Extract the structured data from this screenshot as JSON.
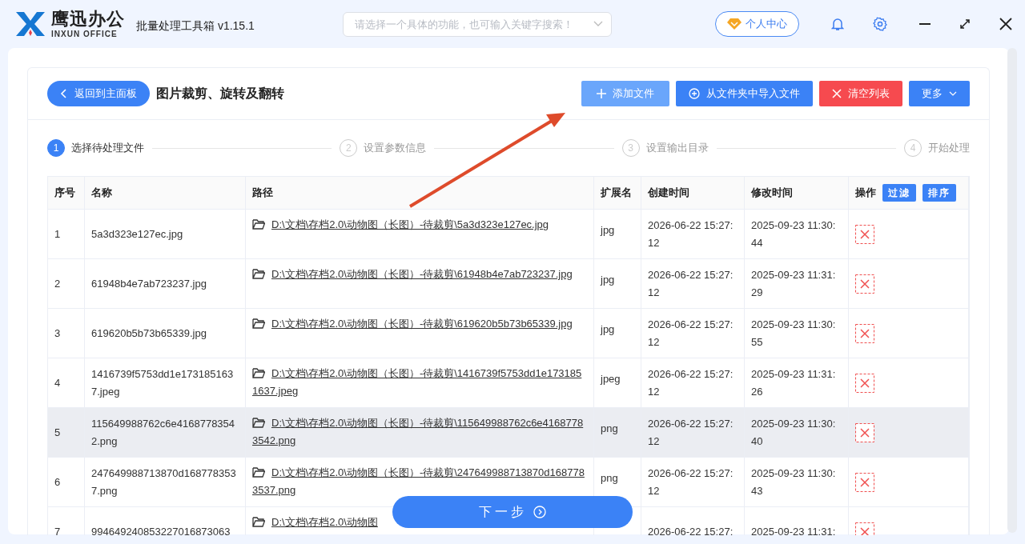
{
  "app": {
    "logo_cn": "鹰迅办公",
    "logo_en": "INXUN OFFICE",
    "title": "批量处理工具箱 v1.15.1"
  },
  "search": {
    "placeholder": "请选择一个具体的功能，也可输入关键字搜索！"
  },
  "user_center": "个人中心",
  "toolbar": {
    "back": "返回到主面板",
    "title": "图片裁剪、旋转及翻转",
    "buttons": [
      {
        "kind": "add",
        "label": "添加文件"
      },
      {
        "kind": "import",
        "label": "从文件夹中导入文件"
      },
      {
        "kind": "clear",
        "label": "清空列表"
      },
      {
        "kind": "more",
        "label": "更多"
      }
    ]
  },
  "steps": [
    {
      "number": "1",
      "label": "选择待处理文件",
      "selected": true
    },
    {
      "number": "2",
      "label": "设置参数信息",
      "selected": false
    },
    {
      "number": "3",
      "label": "设置输出目录",
      "selected": false
    },
    {
      "number": "4",
      "label": "开始处理",
      "selected": false
    }
  ],
  "table": {
    "columns": [
      "序号",
      "名称",
      "路径",
      "扩展名",
      "创建时间",
      "修改时间",
      "操作"
    ],
    "filter": "过滤",
    "sort": "排序",
    "rows": [
      {
        "index": "1",
        "name": "5a3d323e127ec.jpg",
        "path": "D:\\文档\\存档2.0\\动物图（长图）-待裁剪\\5a3d323e127ec.jpg",
        "ext": "jpg",
        "created": "2026-06-22 15:27:12",
        "modified": "2025-09-23 11:30:44",
        "selected": false
      },
      {
        "index": "2",
        "name": "61948b4e7ab723237.jpg",
        "path": "D:\\文档\\存档2.0\\动物图（长图）-待裁剪\\61948b4e7ab723237.jpg",
        "ext": "jpg",
        "created": "2026-06-22 15:27:12",
        "modified": "2025-09-23 11:31:29",
        "selected": false
      },
      {
        "index": "3",
        "name": "619620b5b73b65339.jpg",
        "path": "D:\\文档\\存档2.0\\动物图（长图）-待裁剪\\619620b5b73b65339.jpg",
        "ext": "jpg",
        "created": "2026-06-22 15:27:12",
        "modified": "2025-09-23 11:30:55",
        "selected": false
      },
      {
        "index": "4",
        "name": "1416739f5753dd1e1731851637.jpeg",
        "path": "D:\\文档\\存档2.0\\动物图（长图）-待裁剪\\1416739f5753dd1e1731851637.jpeg",
        "ext": "jpeg",
        "created": "2026-06-22 15:27:12",
        "modified": "2025-09-23 11:31:26",
        "selected": false
      },
      {
        "index": "5",
        "name": "115649988762c6e41687783542.png",
        "path": "D:\\文档\\存档2.0\\动物图（长图）-待裁剪\\115649988762c6e41687783542.png",
        "ext": "png",
        "created": "2026-06-22 15:27:12",
        "modified": "2025-09-23 11:30:40",
        "selected": true
      },
      {
        "index": "6",
        "name": "247649988713870d1687783537.png",
        "path": "D:\\文档\\存档2.0\\动物图（长图）-待裁剪\\247649988713870d1687783537.png",
        "ext": "png",
        "created": "2026-06-22 15:27:12",
        "modified": "2025-09-23 11:30:43",
        "selected": false
      },
      {
        "index": "7",
        "name": "994649240853227016873063",
        "path": "D:\\文档\\存档2.0\\动物图",
        "created": "2026-06-22 15:27:",
        "modified": "2025-09-23 11:31:",
        "selected": false
      }
    ]
  },
  "next_button": "下一步"
}
